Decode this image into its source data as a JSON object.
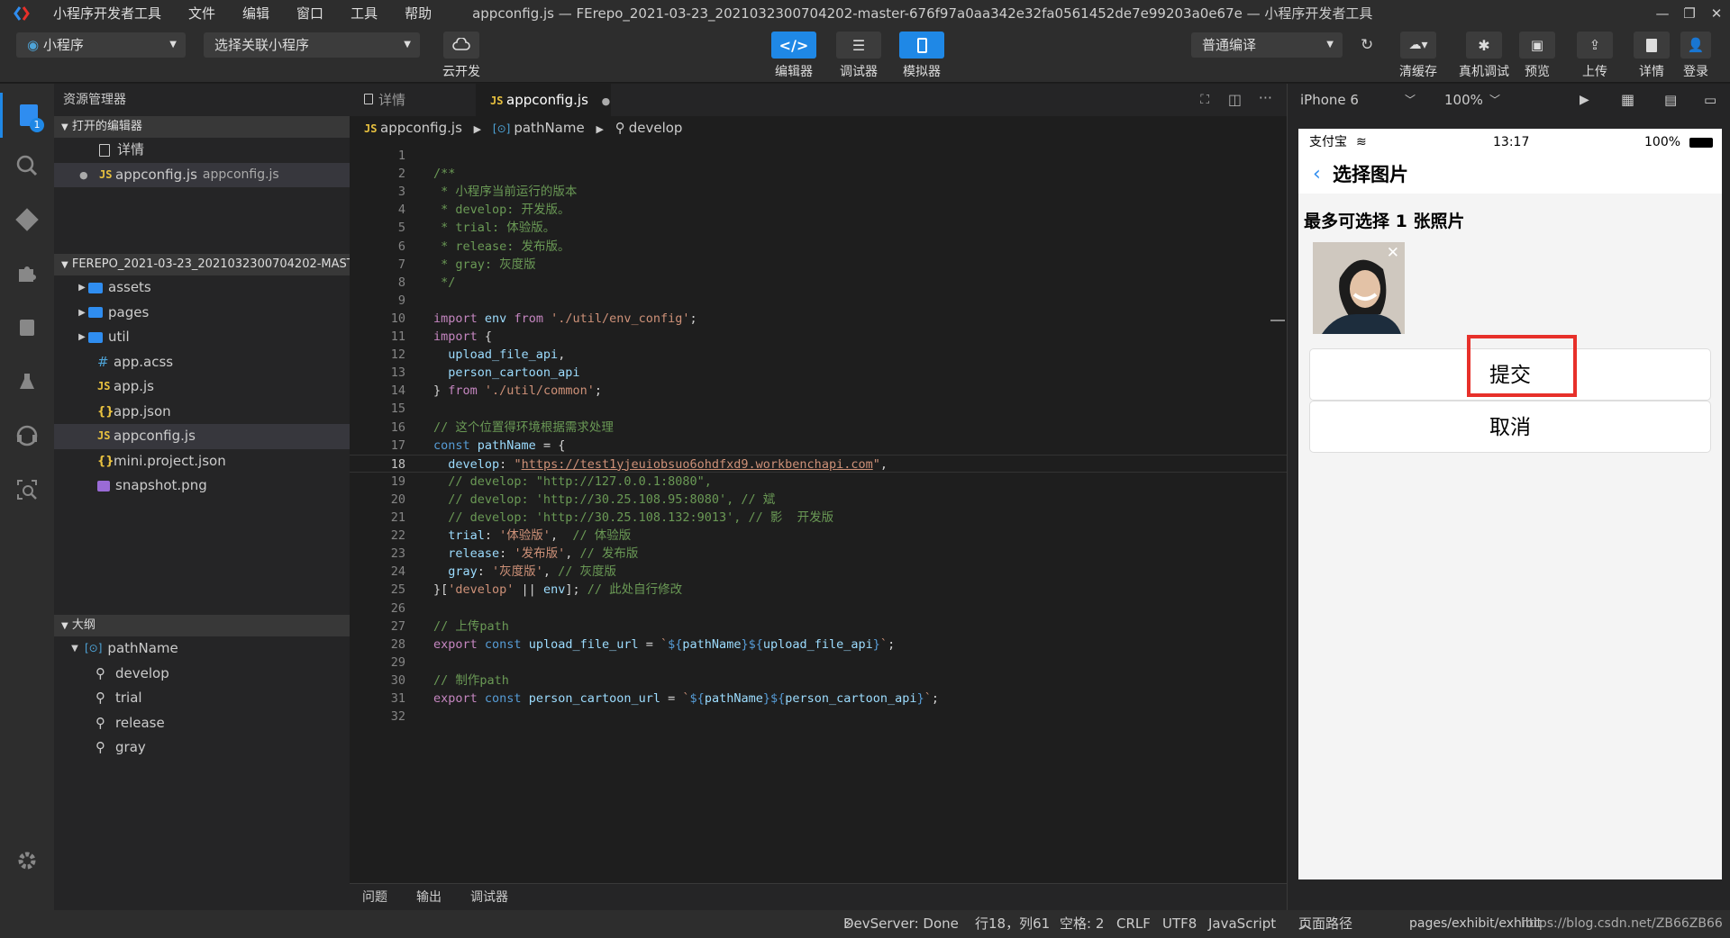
{
  "titlebar": {
    "menu": [
      "小程序开发者工具",
      "文件",
      "编辑",
      "窗口",
      "工具",
      "帮助"
    ],
    "title": "appconfig.js — FErepo_2021-03-23_2021032300704202-master-676f97a0aa342e32fa0561452de7e99203a0e67e — 小程序开发者工具"
  },
  "toolbar": {
    "project_select": "小程序",
    "related_select": "选择关联小程序",
    "cloud_label": "云开发",
    "editor_label": "编辑器",
    "debugger_label": "调试器",
    "simulator_label": "模拟器",
    "compile_select": "普通编译",
    "clear_cache_label": "清缓存",
    "device_debug_label": "真机调试",
    "preview_label": "预览",
    "upload_label": "上传",
    "details_label": "详情",
    "login_label": "登录"
  },
  "activity": {
    "badge": "1"
  },
  "sidebar": {
    "header": "资源管理器",
    "open_editors_label": "打开的编辑器",
    "open_editors": [
      {
        "label": "详情"
      },
      {
        "label": "appconfig.js",
        "path": "appconfig.js"
      }
    ],
    "project_label": "FEREPO_2021-03-23_2021032300704202-MAST...",
    "files": [
      {
        "label": "assets",
        "type": "folder"
      },
      {
        "label": "pages",
        "type": "folder"
      },
      {
        "label": "util",
        "type": "folder"
      },
      {
        "label": "app.acss",
        "type": "acss"
      },
      {
        "label": "app.js",
        "type": "js"
      },
      {
        "label": "app.json",
        "type": "json"
      },
      {
        "label": "appconfig.js",
        "type": "js"
      },
      {
        "label": "mini.project.json",
        "type": "json"
      },
      {
        "label": "snapshot.png",
        "type": "image"
      }
    ],
    "outline_label": "大纲",
    "outline_root": "pathName",
    "outline_items": [
      "develop",
      "trial",
      "release",
      "gray"
    ]
  },
  "editor": {
    "tabs": [
      {
        "label": "详情"
      },
      {
        "label": "appconfig.js"
      }
    ],
    "breadcrumb": [
      "appconfig.js",
      "pathName",
      "develop"
    ],
    "current_line": 18,
    "code": [
      "",
      "/**",
      " * 小程序当前运行的版本",
      " * develop: 开发版。",
      " * trial: 体验版。",
      " * release: 发布版。",
      " * gray: 灰度版",
      " */",
      "",
      "import env from './util/env_config';",
      "import {",
      "  upload_file_api,",
      "  person_cartoon_api",
      "} from './util/common';",
      "",
      "// 这个位置得环境根据需求处理",
      "const pathName = {",
      "  develop: \"https://test1yjeuiobsuo6ohdfxd9.workbenchapi.com\",",
      "  // develop: \"http://127.0.0.1:8080\",",
      "  // develop: 'http://30.25.108.95:8080', // 斌",
      "  // develop: 'http://30.25.108.132:9013', // 影  开发版",
      "  trial: '体验版',  // 体验版",
      "  release: '发布版', // 发布版",
      "  gray: '灰度版', // 灰度版",
      "}['develop' || env]; // 此处自行修改",
      "",
      "// 上传path",
      "export const upload_file_url = `${pathName}${upload_file_api}`;",
      "",
      "// 制作path",
      "export const person_cartoon_url = `${pathName}${person_cartoon_api}`;",
      ""
    ]
  },
  "bottom_tabs": [
    "问题",
    "输出",
    "调试器"
  ],
  "simulator": {
    "device": "iPhone 6",
    "zoom": "100%",
    "status_left": "支付宝",
    "status_time": "13:17",
    "status_battery": "100%",
    "nav_title": "选择图片",
    "page_title": "最多可选择 1 张照片",
    "submit_label": "提交",
    "cancel_label": "取消"
  },
  "statusbar": {
    "devserver": "DevServer: Done",
    "position": "行18，列61",
    "spaces": "空格: 2",
    "eol": "CRLF",
    "encoding": "UTF8",
    "language": "JavaScript",
    "page_path_label": "页面路径",
    "page_path": "pages/exhibit/exhibit",
    "watermark": "https://blog.csdn.net/ZB66ZB66"
  },
  "colors": {
    "accent": "#1f88e6",
    "highlight": "#e7302a"
  }
}
